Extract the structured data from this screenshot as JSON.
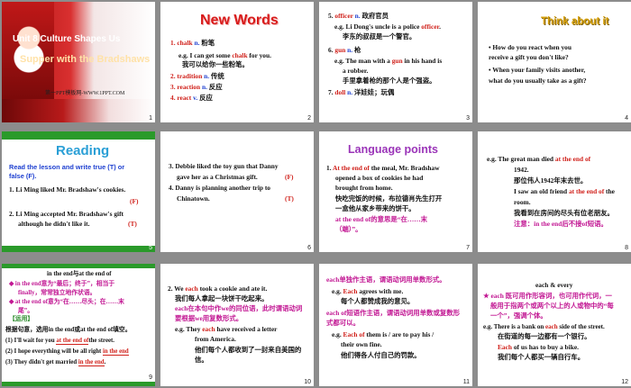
{
  "slide1": {
    "unit": "Unit 8  Culture Shapes Us",
    "title": "Supper with the Bradshaws",
    "footer": "第一PPT模板网-WWW.1PPT.COM",
    "num": "1"
  },
  "slide2": {
    "title": "New Words",
    "lines": [
      "1. chalk n.  粉笔",
      "e.g. I can get some chalk for you.",
      "我可以给你一些粉笔。",
      "2. tradition  n. 传统",
      "3. reaction  n.  反应",
      "4. react   v.  反应"
    ],
    "num": "2"
  },
  "slide3": {
    "lines": [
      "5. officer n.  政府官员",
      "e.g. Li Dong's uncle is a police officer.",
      "李东的叔叔是一个警官。",
      "6. gun  n.  枪",
      "e.g. The man with a gun in his hand is",
      "a robber.",
      "手里拿着枪的那个人是个强盗。",
      "7. doll  n.  洋娃娃；玩偶"
    ],
    "num": "3"
  },
  "slide4": {
    "title": "Think about it",
    "lines": [
      "• How do you react when you",
      "  receive a gift you don't like?",
      "• When your family  visits another,",
      "  what do you usually take as a gift?"
    ],
    "num": "4"
  },
  "slide5": {
    "title": "Reading",
    "instruction": [
      "Read the lesson and write true (T) or",
      "false (F)."
    ],
    "lines": [
      "1. Li Ming liked Mr. Bradshaw's cookies.",
      "(F)",
      "2. Li Ming accepted Mr. Bradshaw's gift",
      "although he didn't like it.",
      "(T)"
    ],
    "num": "5"
  },
  "slide6": {
    "lines": [
      "3. Debbie liked the toy gun that Danny",
      "gave her as a Christmas gift.",
      "(F)",
      "4. Danny is planning another trip to",
      "Chinatown.",
      "(T)"
    ],
    "num": "6"
  },
  "slide7": {
    "title": "Language points",
    "lines": [
      "1. At the end of the meal, Mr. Bradshaw",
      "opened a box of cookies he had",
      "brought from home.",
      "快吃完饭的时候，布拉德肖先生打开",
      "一盒他从家乡带来的饼干。",
      "at the end of的意思是“在……末",
      "（端）”。"
    ],
    "num": "7"
  },
  "slide8": {
    "lines": [
      "e.g. The great man died at the end of",
      "1942.",
      "那位伟人1942年末去世。",
      "I saw an old friend at the end of the",
      "room.",
      "我看到在房间的尽头有位老朋友。",
      "注意：in the end后不接of短语。"
    ],
    "num": "8"
  },
  "slide9": {
    "lines": [
      "in the end与at the end of",
      "◆ in the end意为“最后；终于”，相当于",
      "finally，常常独立地作状语。",
      "◆ at the end of意为“在……尽头；在……末",
      "尾”。",
      "【运用】",
      "根据句意，选用in the end或at the end of填空。",
      "(1) I'll wait for you ",
      "the street.",
      "(2) I hope everything will be all right ",
      "(3) They didn't get married ",
      "."
    ],
    "answers": [
      "at the end of",
      "in the end",
      "in the end"
    ],
    "num": "9"
  },
  "slide10": {
    "lines": [
      "2. We each took a cookie and ate it.",
      "我们每人拿起一块饼干吃起来。",
      "each在本句中作we的同位语，此时谓语动词",
      "要根据we用复数形式。",
      "e.g. They each have received a letter",
      "from America.",
      "他们每个人都收到了一封来自美国的",
      "信。"
    ],
    "num": "10"
  },
  "slide11": {
    "lines": [
      "each单独作主语，谓语动词用单数形式。",
      "e.g. Each agrees with me.",
      "每个人都赞成我的意见。",
      "each of短语作主语，谓语动词用单数或复数形",
      "式都可以。",
      "e.g. Each of them is / are to pay his /",
      "their own fine.",
      "他们得各人付自己的罚款。"
    ],
    "num": "11"
  },
  "slide12": {
    "lines": [
      "each & every",
      "★ each 既可用作形容词，也可用作代词，一",
      "般用于指两个或两个以上的人或物中的“每",
      "一个”，强调个体。",
      "e.g. There is a bank on each side of the street.",
      "在街道的每一边都有一个银行。",
      "Each of us has to buy a bike.",
      "我们每个人都买一辆自行车。"
    ],
    "num": "12"
  },
  "colors": {
    "background": "#8c8c8c",
    "accent_red": "#d0201a",
    "accent_blue": "#1d3fd0",
    "accent_magenta": "#c21793"
  }
}
